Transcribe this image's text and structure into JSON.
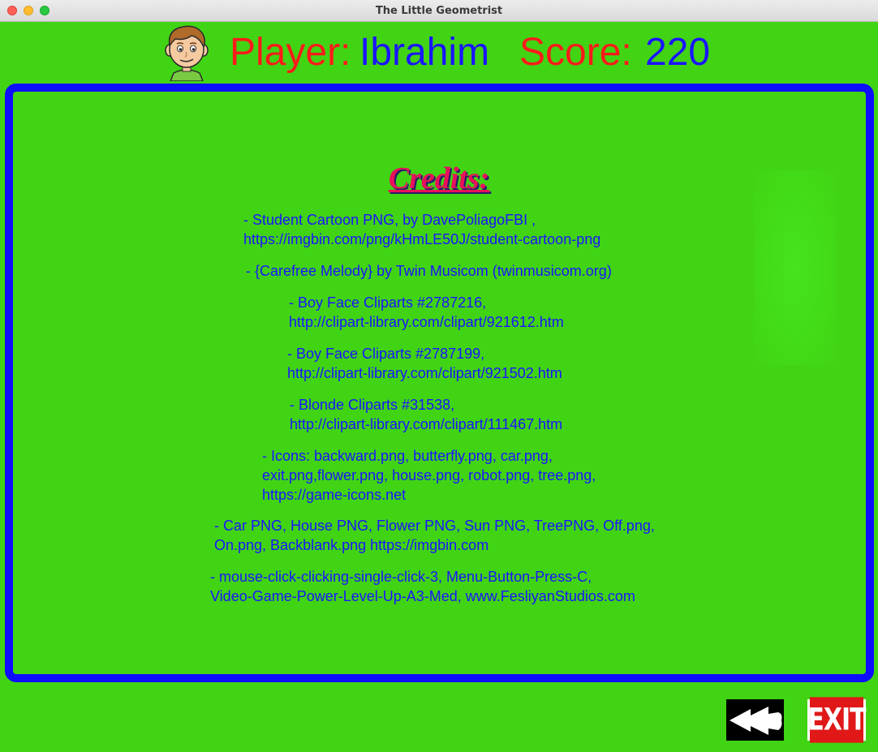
{
  "window": {
    "title": "The Little Geometrist"
  },
  "header": {
    "player_label": "Player:",
    "player_name": "Ibrahim",
    "score_label": "Score:",
    "score_value": "220",
    "avatar_icon": "boy-face-avatar"
  },
  "credits": {
    "title": "Credits:",
    "entries": [
      {
        "line1": "- Student Cartoon PNG, by DavePoliagoFBI ,",
        "line2": " https://imgbin.com/png/kHmLE50J/student-cartoon-png"
      },
      {
        "line1": "- {Carefree Melody} by Twin Musicom (twinmusicom.org)"
      },
      {
        "line1": "- Boy Face Cliparts #2787216,",
        "line2": " http://clipart-library.com/clipart/921612.htm"
      },
      {
        "line1": "- Boy Face Cliparts #2787199,",
        "line2": " http://clipart-library.com/clipart/921502.htm"
      },
      {
        "line1": "- Blonde Cliparts #31538,",
        "line2": " http://clipart-library.com/clipart/111467.htm"
      },
      {
        "line1": "- Icons: backward.png, butterfly.png, car.png,",
        "line2": " exit.png,flower.png, house.png, robot.png, tree.png,",
        "line3": " https://game-icons.net"
      },
      {
        "line1": "- Car PNG, House PNG, Flower PNG, Sun PNG, TreePNG, Off.png,",
        "line2": " On.png, Backblank.png https://imgbin.com"
      },
      {
        "line1": "- mouse-click-clicking-single-click-3, Menu-Button-Press-C,",
        "line2": "Video-Game-Power-Level-Up-A3-Med, www.FesliyanStudios.com"
      }
    ]
  },
  "buttons": {
    "back_icon": "backward-icon",
    "exit_label": "EXIT"
  },
  "colors": {
    "background": "#41d414",
    "label_red": "#ff1a1a",
    "value_blue": "#1a14ff",
    "panel_border": "#0d0dff",
    "credits_title": "#e8105a"
  }
}
